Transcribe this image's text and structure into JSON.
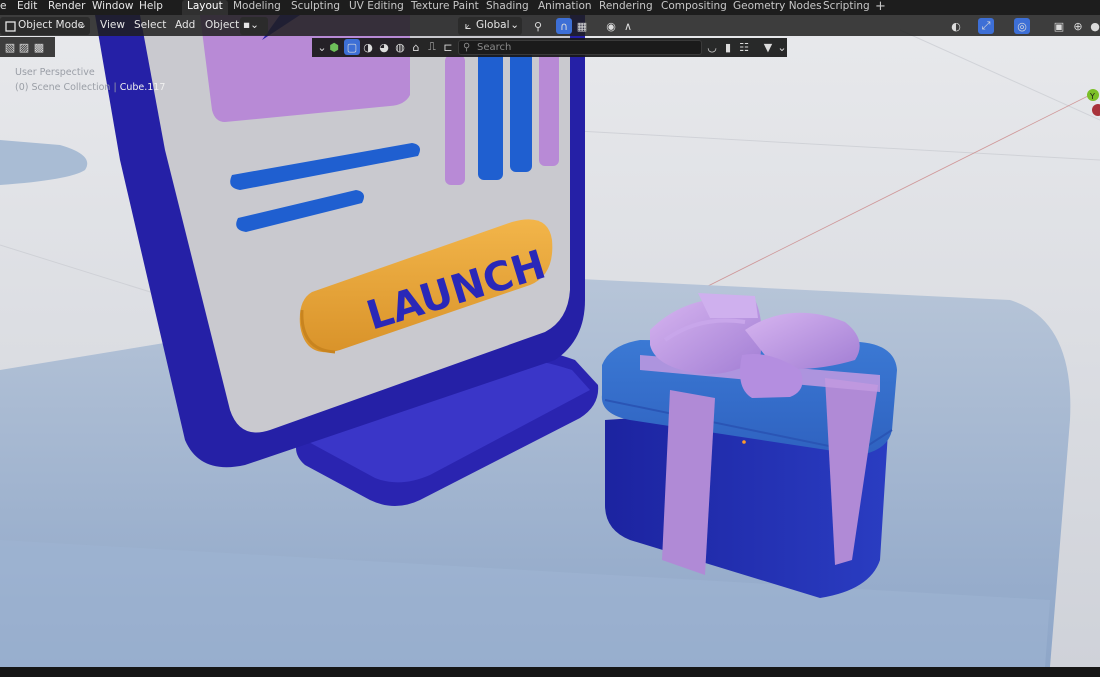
{
  "menu": {
    "items": [
      "e",
      "Edit",
      "Render",
      "Window",
      "Help"
    ]
  },
  "workspaces": {
    "tabs": [
      "Layout",
      "Modeling",
      "Sculpting",
      "UV Editing",
      "Texture Paint",
      "Shading",
      "Animation",
      "Rendering",
      "Compositing",
      "Geometry Nodes",
      "Scripting"
    ],
    "active": "Layout",
    "add_symbol": "+"
  },
  "viewport_header": {
    "mode": "Object Mode",
    "view": "View",
    "select": "Select",
    "add": "Add",
    "object": "Object",
    "transform_orientation": "Global",
    "search_placeholder": "Search"
  },
  "overlay": {
    "perspective": "User Perspective",
    "collection": "(0) Scene Collection |",
    "active_object": "Cube.117"
  },
  "scene": {
    "button_label": "LAUNCH",
    "gizmo_axis": "Y"
  },
  "colors": {
    "accent_active_tab": "#303030",
    "button_orange": "#e9a83a",
    "panel_blue": "#2a24a6",
    "gift_blue": "#2334a8",
    "ribbon_purple": "#b58ee0"
  }
}
